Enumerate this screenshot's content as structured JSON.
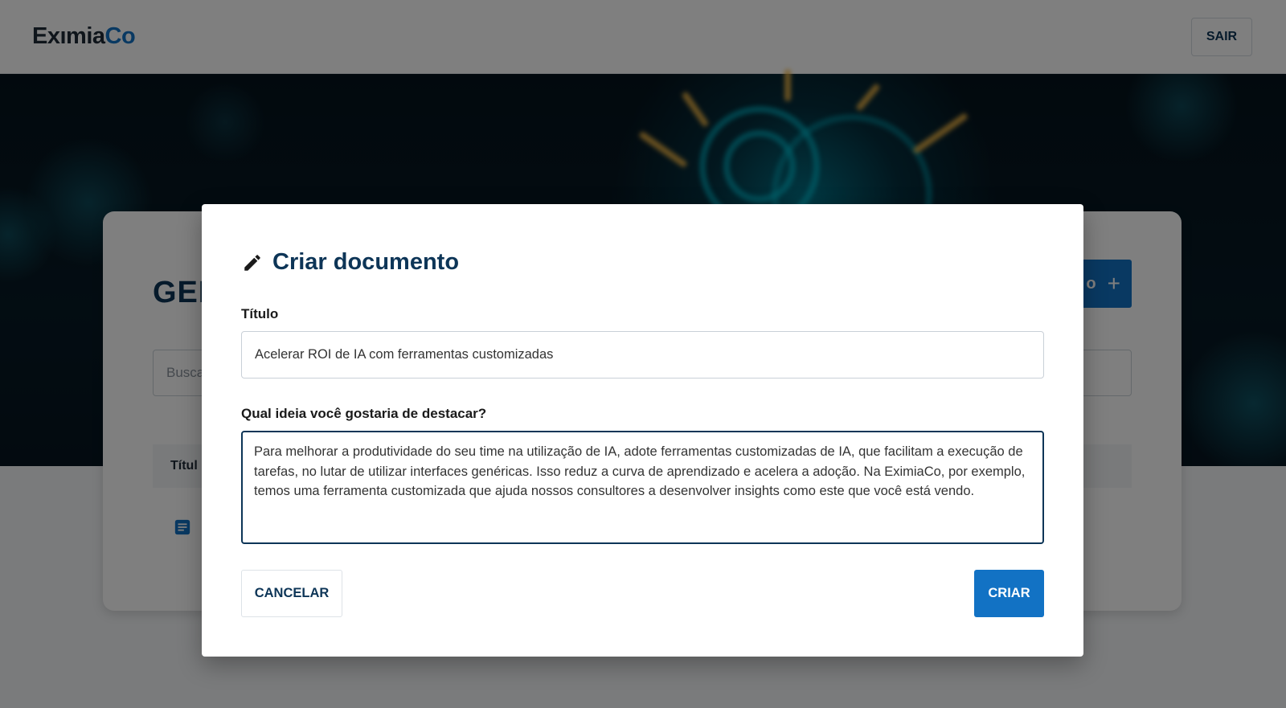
{
  "header": {
    "logo_left": "Exımia",
    "logo_right": "Co",
    "logout_label": "SAIR"
  },
  "card": {
    "title": "GER",
    "new_button_partial": "o",
    "new_button_icon": "+",
    "search_placeholder": "Busca",
    "table_column_title": "Títul",
    "row_icon": "document-icon"
  },
  "modal": {
    "icon": "pencil-icon",
    "title": "Criar documento",
    "title_field_label": "Título",
    "title_field_value": "Acelerar ROI de IA com ferramentas customizadas",
    "idea_field_label": "Qual ideia você gostaria de destacar?",
    "idea_field_value": "Para melhorar a produtividade do seu time na utilização de IA, adote ferramentas customizadas de IA, que facilitam a execução de tarefas, no lutar de utilizar interfaces genéricas. Isso reduz a curva de aprendizado e acelera a adoção. Na EximiaCo, por exemplo, temos uma ferramenta customizada que ajuda nossos consultores a desenvolver insights como este que você está vendo.",
    "cancel_label": "CANCELAR",
    "create_label": "CRIAR"
  },
  "colors": {
    "brand_dark": "#0d3557",
    "brand_blue": "#1272c4"
  }
}
